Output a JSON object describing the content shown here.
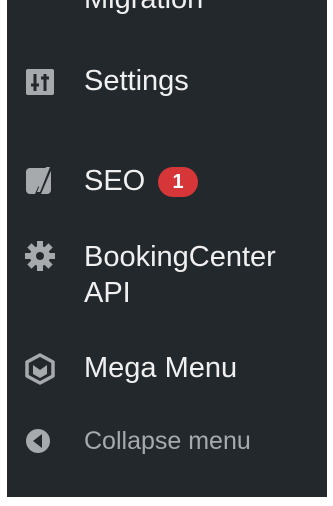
{
  "menu": {
    "migration_label": "Migration",
    "settings": {
      "label": "Settings",
      "icon": "settings-sliders-icon"
    },
    "seo": {
      "label": "SEO",
      "badge": "1",
      "icon": "yoast-seo-icon"
    },
    "booking": {
      "label": "BookingCenter API",
      "icon": "gear-icon"
    },
    "mega_menu": {
      "label": "Mega Menu",
      "icon": "mega-menu-icon"
    },
    "collapse": {
      "label": "Collapse menu",
      "icon": "collapse-arrow-icon"
    }
  },
  "colors": {
    "sidebar_bg": "#23282d",
    "text": "#f0f0f1",
    "muted": "#a7aaad",
    "badge": "#d63638"
  }
}
